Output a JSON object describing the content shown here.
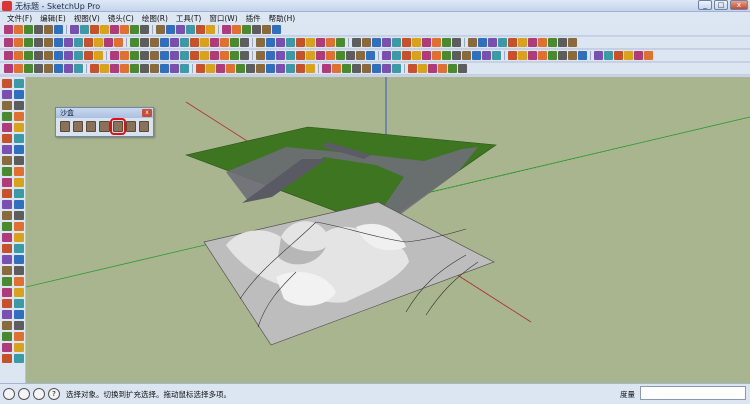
{
  "window": {
    "title": "无标题 - SketchUp Pro",
    "minimize_label": "_",
    "maximize_label": "□",
    "close_label": "x"
  },
  "menu": [
    "文件(F)",
    "编辑(E)",
    "视图(V)",
    "镜头(C)",
    "绘图(R)",
    "工具(T)",
    "窗口(W)",
    "插件",
    "帮助(H)"
  ],
  "sandbox_toolbar": {
    "title": "沙盒",
    "close_label": "x",
    "tools": [
      "from-contours-icon",
      "from-scratch-icon",
      "smoove-icon",
      "stamp-icon",
      "drape-icon",
      "add-detail-icon",
      "flip-edge-icon"
    ],
    "highlighted_tool_index": 4,
    "highlight_color": "#e01010"
  },
  "status_bar": {
    "help_icon_label": "?",
    "message": "选择对象。切换到扩充选择。拖动鼠标选择多项。",
    "measurement_label": "度量",
    "measurement_value": ""
  },
  "colors": {
    "viewport_bg": "#a9b58f",
    "terrain_green": "#3d7520",
    "road_gray": "#6e6e78",
    "terrain_base": "#b8b8b8",
    "axis_red": "#b03030",
    "axis_green": "#2f9a2f",
    "axis_blue": "#2040c0"
  }
}
